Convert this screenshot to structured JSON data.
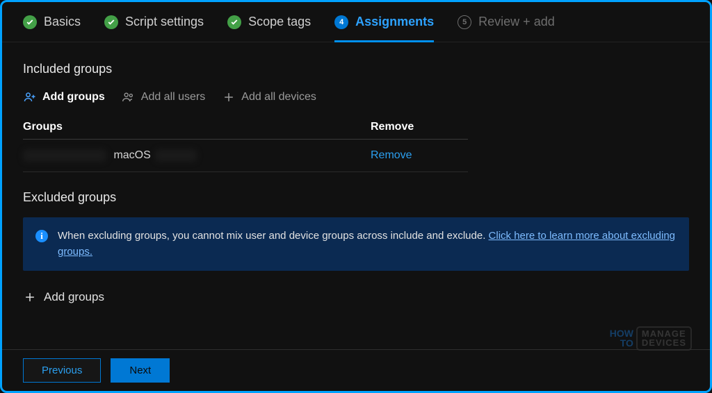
{
  "tabs": {
    "basics": {
      "label": "Basics"
    },
    "script": {
      "label": "Script settings"
    },
    "scope": {
      "label": "Scope tags"
    },
    "assign": {
      "label": "Assignments",
      "number": "4"
    },
    "review": {
      "label": "Review + add",
      "number": "5"
    }
  },
  "included": {
    "title": "Included groups",
    "add_groups": "Add groups",
    "add_all_users": "Add all users",
    "add_all_devices": "Add all devices",
    "col_groups": "Groups",
    "col_remove": "Remove",
    "row_text": "macOS",
    "remove": "Remove"
  },
  "excluded": {
    "title": "Excluded groups",
    "info_text": "When excluding groups, you cannot mix user and device groups across include and exclude. ",
    "info_link": "Click here to learn more about excluding groups.",
    "add_groups": "Add groups"
  },
  "footer": {
    "previous": "Previous",
    "next": "Next"
  },
  "watermark": {
    "how": "HOW",
    "to": "TO",
    "manage": "MANAGE",
    "devices": "DEVICES"
  }
}
